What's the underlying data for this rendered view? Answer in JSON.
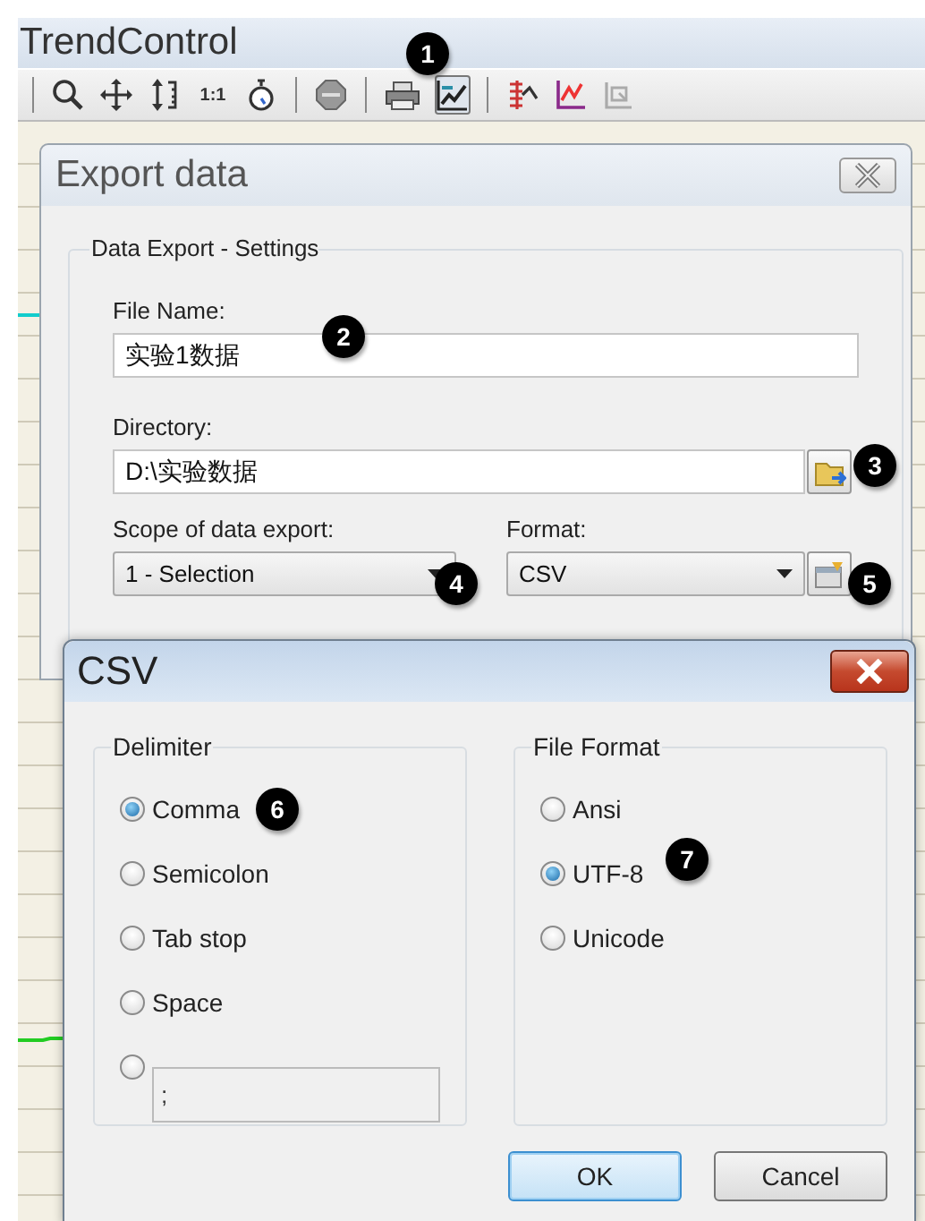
{
  "window": {
    "title": "TrendControl"
  },
  "toolbar": [
    {
      "kind": "separator"
    },
    {
      "kind": "tool",
      "selected": false
    },
    {
      "kind": "tool",
      "selected": false
    },
    {
      "kind": "tool",
      "selected": false
    },
    {
      "kind": "text-tool",
      "label": "1:1",
      "selected": false
    },
    {
      "kind": "tool",
      "selected": false
    },
    {
      "kind": "separator"
    },
    {
      "kind": "tool",
      "selected": false
    },
    {
      "kind": "separator"
    },
    {
      "kind": "tool",
      "selected": false
    },
    {
      "kind": "tool",
      "selected": true
    },
    {
      "kind": "separator"
    },
    {
      "kind": "tool",
      "selected": false
    },
    {
      "kind": "tool",
      "selected": false
    },
    {
      "kind": "tool",
      "selected": false
    }
  ],
  "export_dialog": {
    "title": "Export data",
    "active": false,
    "group": "Data Export - Settings",
    "file_name": {
      "label": "File Name:",
      "value": "实验1数据"
    },
    "directory": {
      "label": "Directory:",
      "value": "D:\\实验数据"
    },
    "scope": {
      "label": "Scope of data export:",
      "value": "1 - Selection"
    },
    "format": {
      "label": "Format:",
      "value": "CSV"
    }
  },
  "csv_dialog": {
    "title": "CSV",
    "active": true,
    "delimiter": {
      "title": "Delimiter",
      "options": [
        {
          "kind": "radio",
          "label": "Comma",
          "selected": true
        },
        {
          "kind": "radio",
          "label": "Semicolon",
          "selected": false
        },
        {
          "kind": "radio",
          "label": "Tab stop",
          "selected": false
        },
        {
          "kind": "radio",
          "label": "Space",
          "selected": false
        },
        {
          "kind": "custom",
          "value": ";",
          "selected": false
        }
      ]
    },
    "file_format": {
      "title": "File Format",
      "options": [
        {
          "kind": "radio",
          "label": "Ansi",
          "selected": false
        },
        {
          "kind": "radio",
          "label": "UTF-8",
          "selected": true
        },
        {
          "kind": "radio",
          "label": "Unicode",
          "selected": false
        }
      ]
    },
    "buttons": [
      {
        "label": "OK",
        "default": true
      },
      {
        "label": "Cancel",
        "default": false
      }
    ]
  },
  "callouts": [
    {
      "label": "1"
    },
    {
      "label": "2"
    },
    {
      "label": "3"
    },
    {
      "label": "4"
    },
    {
      "label": "5"
    },
    {
      "label": "6"
    },
    {
      "label": "7"
    }
  ]
}
